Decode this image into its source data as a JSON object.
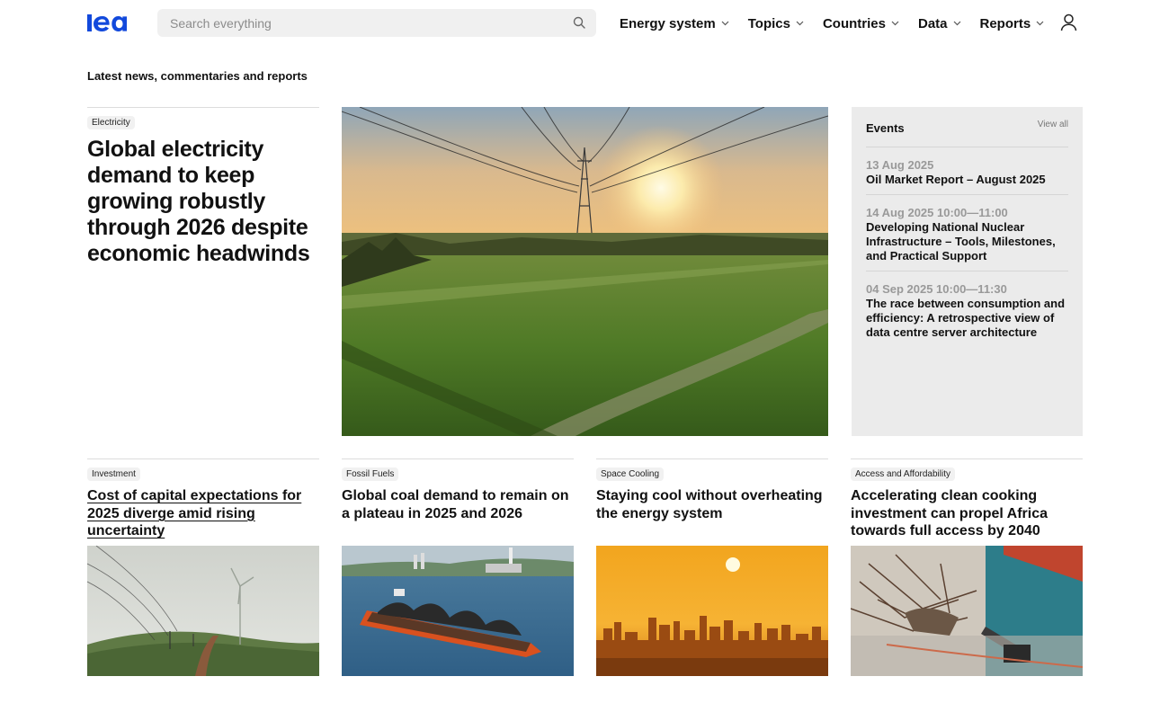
{
  "header": {
    "logo_text": "iea",
    "search_placeholder": "Search everything",
    "nav": [
      {
        "label": "Energy system"
      },
      {
        "label": "Topics"
      },
      {
        "label": "Countries"
      },
      {
        "label": "Data"
      },
      {
        "label": "Reports"
      }
    ]
  },
  "main": {
    "section_title": "Latest news, commentaries and reports",
    "feature": {
      "tag": "Electricity",
      "title": "Global electricity demand to keep growing robustly through 2026 despite economic headwinds"
    },
    "events": {
      "title": "Events",
      "view_all": "View all",
      "items": [
        {
          "date": "13 Aug 2025",
          "title": "Oil Market Report – August 2025"
        },
        {
          "date": "14 Aug 2025 10:00—11:00",
          "title": "Developing National Nuclear Infrastructure – Tools, Milestones, and Practical Support"
        },
        {
          "date": "04 Sep 2025 10:00—11:30",
          "title": "The race between consumption and efficiency: A retrospective view of data centre server architecture"
        }
      ]
    },
    "cards": [
      {
        "tag": "Investment",
        "title": "Cost of capital expectations for 2025 diverge amid rising uncertainty"
      },
      {
        "tag": "Fossil Fuels",
        "title": "Global coal demand to remain on a plateau in 2025 and 2026"
      },
      {
        "tag": "Space Cooling",
        "title": "Staying cool without overheating the energy system"
      },
      {
        "tag": "Access and Affordability",
        "title": "Accelerating clean cooking investment can propel Africa towards full access by 2040"
      }
    ]
  },
  "colors": {
    "brand_blue": "#1249dc",
    "text": "#111111",
    "muted": "#999999",
    "events_bg": "#ebebeb",
    "tag_bg": "#f1f1f1"
  },
  "icons": [
    "search-icon",
    "chevron-down-icon",
    "user-icon"
  ]
}
